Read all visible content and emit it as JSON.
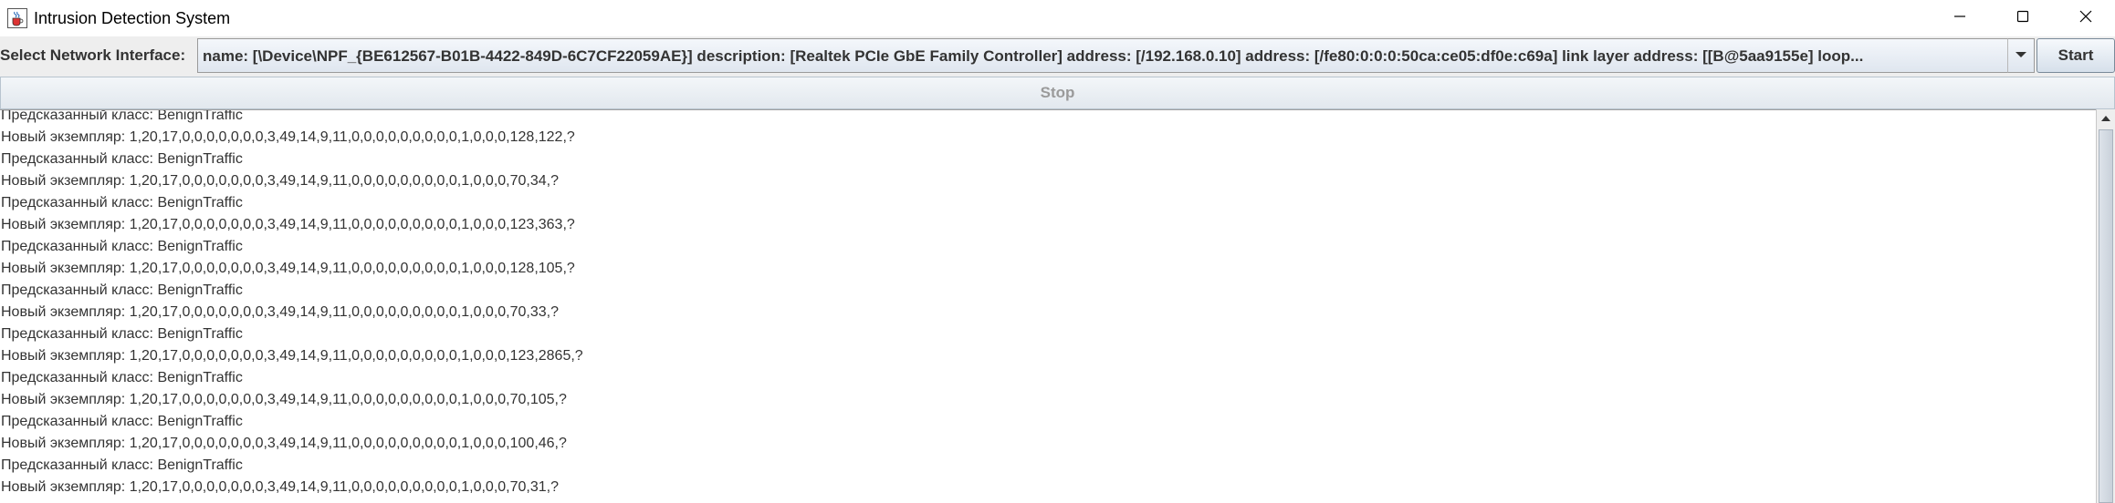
{
  "window": {
    "title": "Intrusion Detection System",
    "icon": "java-coffee-cup-icon",
    "controls": [
      "minimize-icon",
      "maximize-icon",
      "close-icon"
    ]
  },
  "interface_selector": {
    "label": "Select Network Interface:",
    "selected_value": "name: [\\Device\\NPF_{BE612567-B01B-4422-849D-6C7CF22059AE}] description: [Realtek PCIe GbE Family Controller] address: [/192.168.0.10] address: [/fe80:0:0:0:50ca:ce05:df0e:c69a] link layer address: [[B@5aa9155e] loop...",
    "dropdown_icon": "chevron-down-icon"
  },
  "buttons": {
    "start_label": "Start",
    "stop_label": "Stop"
  },
  "log": {
    "lines": [
      "Предсказанный класс: BenignTraffic",
      "Новый экземпляр: 1,20,17,0,0,0,0,0,0,0,3,49,14,9,11,0,0,0,0,0,0,0,0,0,1,0,0,0,128,122,?",
      "Предсказанный класс: BenignTraffic",
      "Новый экземпляр: 1,20,17,0,0,0,0,0,0,0,3,49,14,9,11,0,0,0,0,0,0,0,0,0,1,0,0,0,70,34,?",
      "Предсказанный класс: BenignTraffic",
      "Новый экземпляр: 1,20,17,0,0,0,0,0,0,0,3,49,14,9,11,0,0,0,0,0,0,0,0,0,1,0,0,0,123,363,?",
      "Предсказанный класс: BenignTraffic",
      "Новый экземпляр: 1,20,17,0,0,0,0,0,0,0,3,49,14,9,11,0,0,0,0,0,0,0,0,0,1,0,0,0,128,105,?",
      "Предсказанный класс: BenignTraffic",
      "Новый экземпляр: 1,20,17,0,0,0,0,0,0,0,3,49,14,9,11,0,0,0,0,0,0,0,0,0,1,0,0,0,70,33,?",
      "Предсказанный класс: BenignTraffic",
      "Новый экземпляр: 1,20,17,0,0,0,0,0,0,0,3,49,14,9,11,0,0,0,0,0,0,0,0,0,1,0,0,0,123,2865,?",
      "Предсказанный класс: BenignTraffic",
      "Новый экземпляр: 1,20,17,0,0,0,0,0,0,0,3,49,14,9,11,0,0,0,0,0,0,0,0,0,1,0,0,0,70,105,?",
      "Предсказанный класс: BenignTraffic",
      "Новый экземпляр: 1,20,17,0,0,0,0,0,0,0,3,49,14,9,11,0,0,0,0,0,0,0,0,0,1,0,0,0,100,46,?",
      "Предсказанный класс: BenignTraffic",
      "Новый экземпляр: 1,20,17,0,0,0,0,0,0,0,3,49,14,9,11,0,0,0,0,0,0,0,0,0,1,0,0,0,70,31,?"
    ]
  },
  "colors": {
    "window_bg": "#eeeeee",
    "text": "#333333",
    "disabled_text": "#9a9a9a"
  }
}
